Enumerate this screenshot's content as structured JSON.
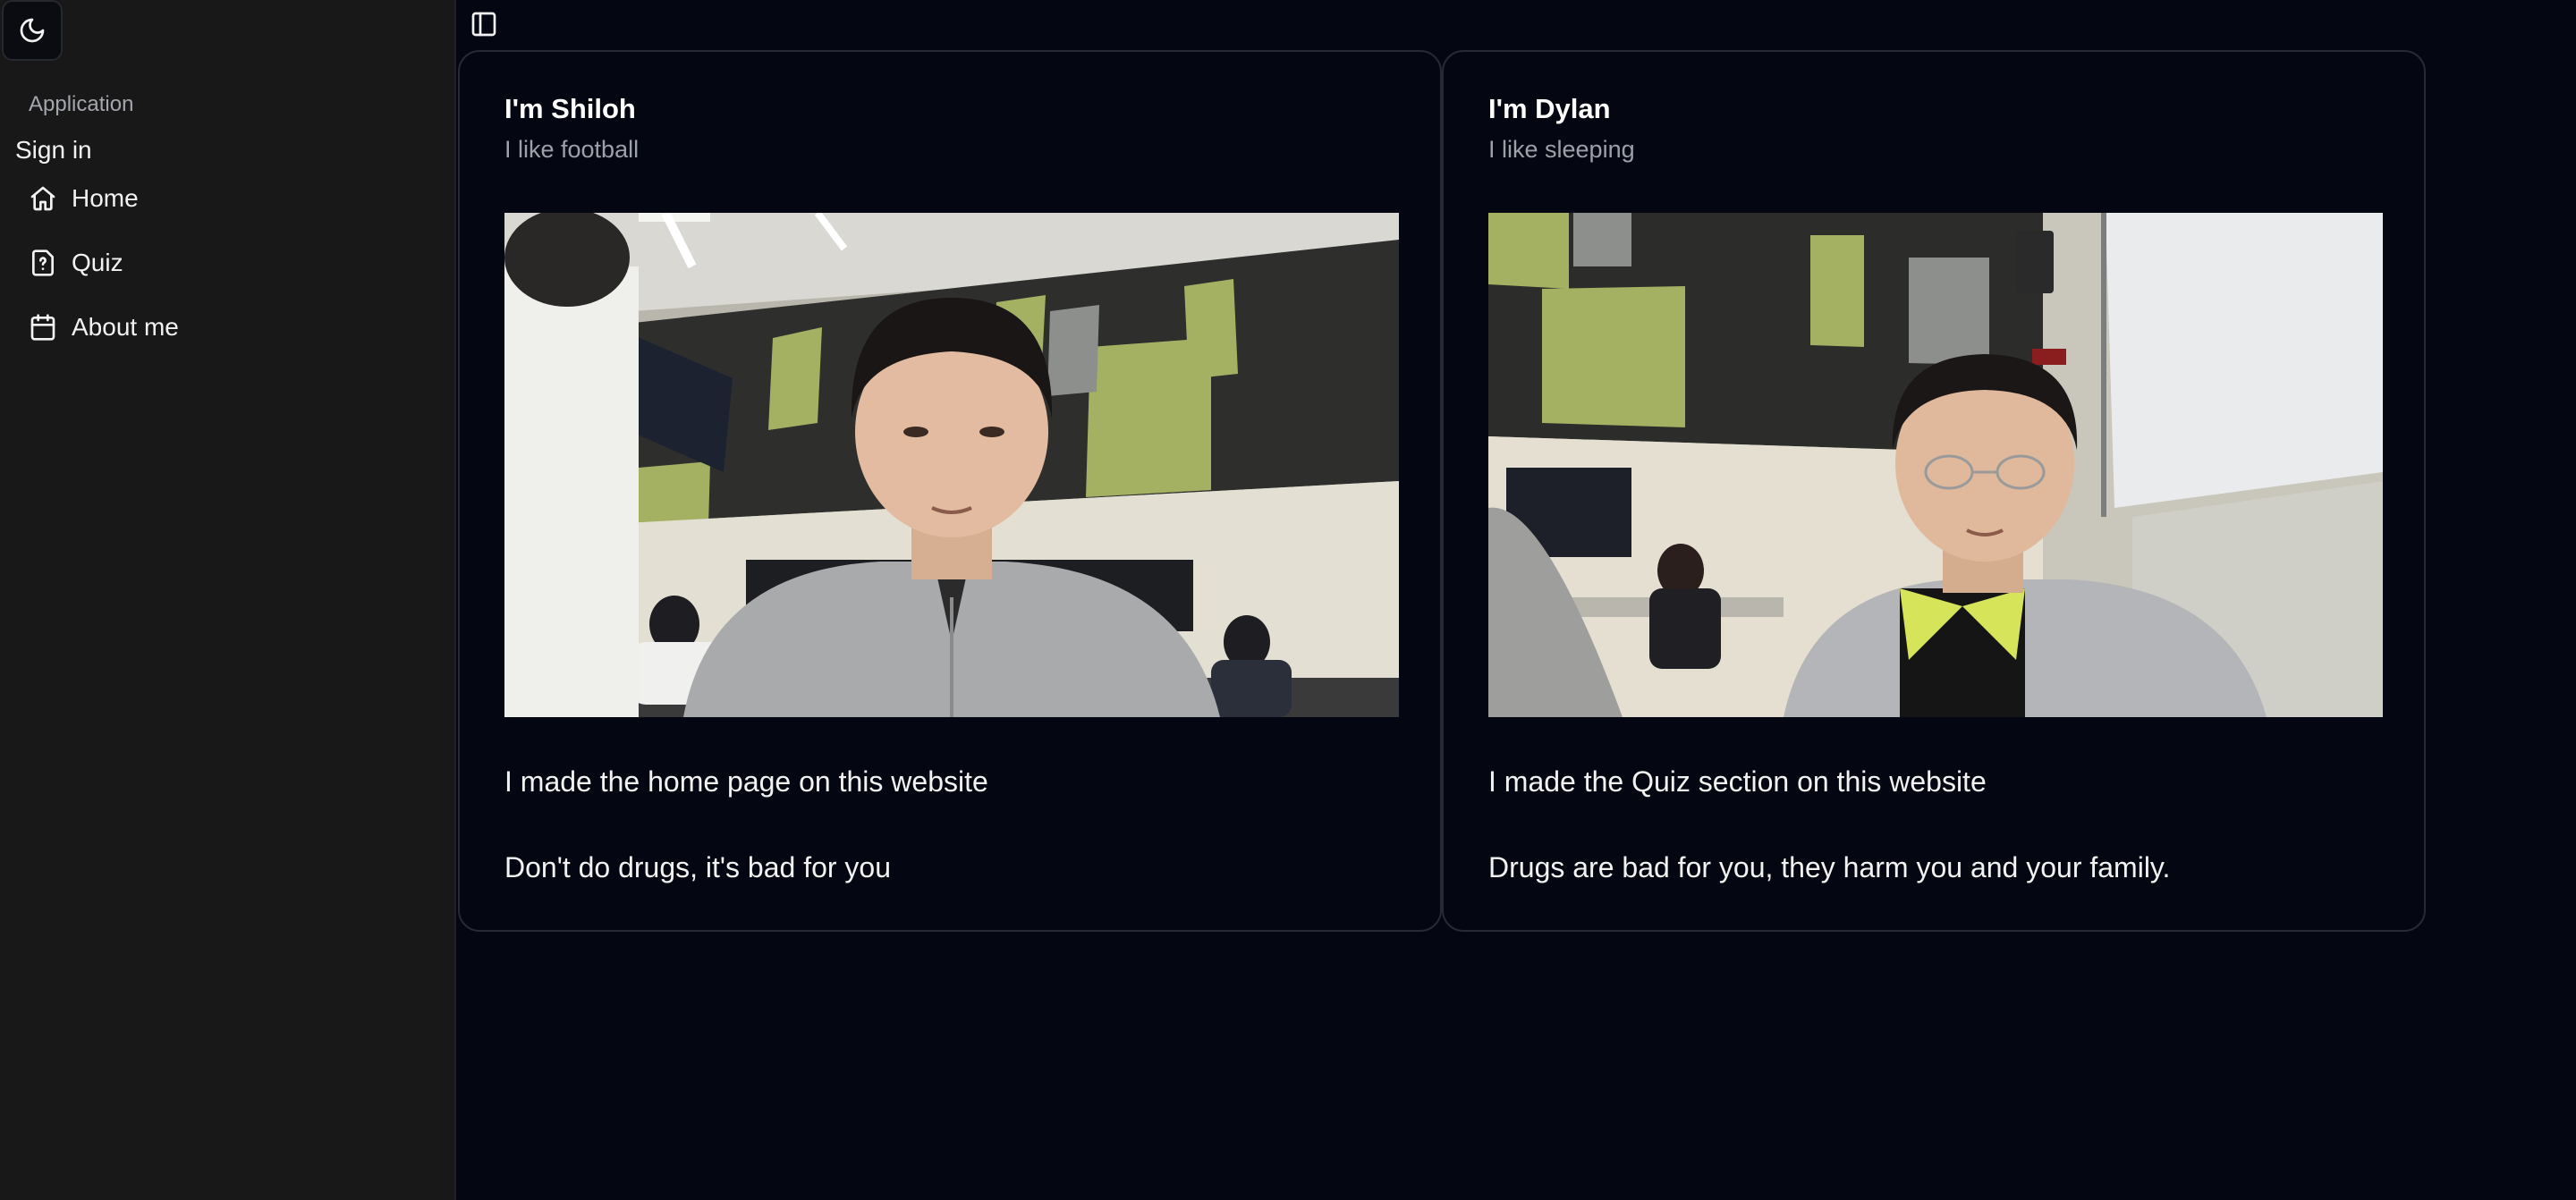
{
  "theme_toggle": {
    "icon": "moon-icon"
  },
  "sidebar": {
    "group_label": "Application",
    "sign_in": "Sign in",
    "items": [
      {
        "label": "Home",
        "icon": "home-icon"
      },
      {
        "label": "Quiz",
        "icon": "file-question-icon"
      },
      {
        "label": "About me",
        "icon": "calendar-icon"
      }
    ]
  },
  "header": {
    "panel_toggle_icon": "panel-left-icon"
  },
  "cards": [
    {
      "title": "I'm Shiloh",
      "subtitle": "I like football",
      "line1": "I made the home page on this website",
      "line2": "Don't do drugs, it's bad for you"
    },
    {
      "title": "I'm Dylan",
      "subtitle": "I like sleeping",
      "line1": "I made the Quiz section on this website",
      "line2": "Drugs are bad for you, they harm you and your family."
    }
  ],
  "colors": {
    "background": "#040711",
    "sidebar": "#181818",
    "card_border": "#262a35",
    "accent_panel": "#a4b163"
  }
}
